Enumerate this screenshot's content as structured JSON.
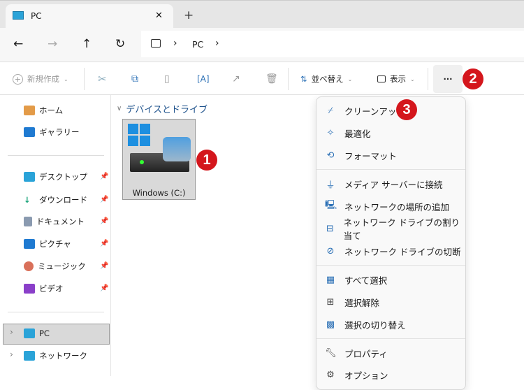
{
  "tab": {
    "title": "PC",
    "close": "✕",
    "new_tab": "+"
  },
  "nav": {
    "back": "←",
    "forward": "→",
    "up": "↑",
    "refresh": "↻",
    "breadcrumb": [
      "PC"
    ],
    "sep": "›"
  },
  "toolbar": {
    "new": "新規作成",
    "sort": "並べ替え",
    "view": "表示",
    "more": "···"
  },
  "sidebar": {
    "items": [
      {
        "label": "ホーム"
      },
      {
        "label": "ギャラリー"
      },
      {
        "label": "デスクトップ"
      },
      {
        "label": "ダウンロード"
      },
      {
        "label": "ドキュメント"
      },
      {
        "label": "ピクチャ"
      },
      {
        "label": "ミュージック"
      },
      {
        "label": "ビデオ"
      },
      {
        "label": "PC"
      },
      {
        "label": "ネットワーク"
      }
    ]
  },
  "main": {
    "section": "デバイスとドライブ",
    "drive": "Windows (C:)"
  },
  "menu": {
    "items": [
      {
        "label": "クリーンアップ"
      },
      {
        "label": "最適化"
      },
      {
        "label": "フォーマット"
      },
      {
        "label": "メディア サーバーに接続"
      },
      {
        "label": "ネットワークの場所の追加"
      },
      {
        "label": "ネットワーク ドライブの割り当て"
      },
      {
        "label": "ネットワーク ドライブの切断"
      },
      {
        "label": "すべて選択"
      },
      {
        "label": "選択解除"
      },
      {
        "label": "選択の切り替え"
      },
      {
        "label": "プロパティ"
      },
      {
        "label": "オプション"
      }
    ]
  },
  "badges": [
    "1",
    "2",
    "3"
  ],
  "colors": {
    "badge": "#d4161c",
    "accent": "#2a6fb5"
  }
}
